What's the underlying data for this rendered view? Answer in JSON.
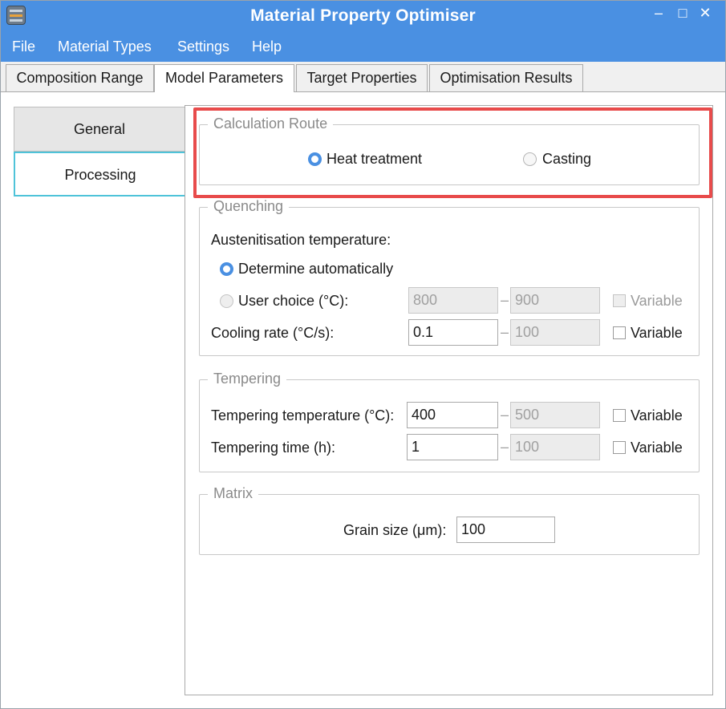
{
  "window": {
    "title": "Material Property Optimiser"
  },
  "titlebar": {
    "minimize_glyph": "–",
    "maximize_glyph": "□",
    "close_glyph": "✕"
  },
  "menu": [
    "File",
    "Material Types",
    "Settings",
    "Help"
  ],
  "tabs": [
    {
      "label": "Composition Range",
      "active": false
    },
    {
      "label": "Model Parameters",
      "active": true
    },
    {
      "label": "Target Properties",
      "active": false
    },
    {
      "label": "Optimisation Results",
      "active": false
    }
  ],
  "sidebar": [
    {
      "label": "General",
      "selected": false
    },
    {
      "label": "Processing",
      "selected": true
    }
  ],
  "calculation_route": {
    "title": "Calculation Route",
    "options": [
      {
        "label": "Heat treatment",
        "selected": true
      },
      {
        "label": "Casting",
        "selected": false
      }
    ]
  },
  "quenching": {
    "title": "Quenching",
    "austenitisation_label": "Austenitisation temperature:",
    "determine_auto_label": "Determine automatically",
    "user_choice_label": "User choice (°C):",
    "user_choice_min": "800",
    "user_choice_max": "900",
    "user_choice_variable": "Variable",
    "cooling_rate_label": "Cooling rate (°C/s):",
    "cooling_rate_min": "0.1",
    "cooling_rate_max": "100",
    "cooling_rate_variable": "Variable"
  },
  "tempering": {
    "title": "Tempering",
    "temp_label": "Tempering temperature (°C):",
    "temp_min": "400",
    "temp_max": "500",
    "temp_variable": "Variable",
    "time_label": "Tempering time (h):",
    "time_min": "1",
    "time_max": "100",
    "time_variable": "Variable"
  },
  "matrix": {
    "title": "Matrix",
    "grain_size_label": "Grain size (μm):",
    "grain_size_value": "100"
  },
  "colors": {
    "titlebar": "#4a90e2",
    "highlight": "#e84b4b",
    "selected_tab_accent": "#4fc3d9"
  }
}
